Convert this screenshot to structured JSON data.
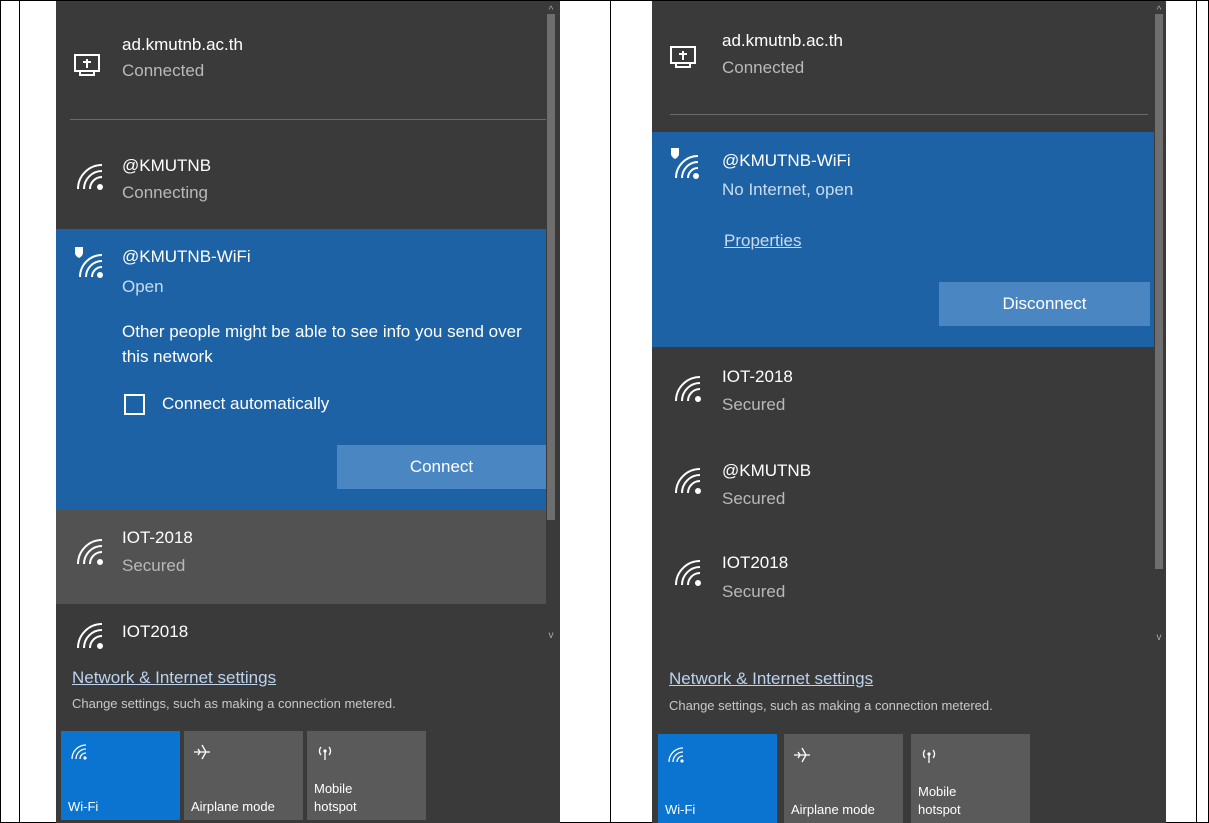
{
  "left": {
    "wired": {
      "name": "ad.kmutnb.ac.th",
      "status": "Connected"
    },
    "networks": [
      {
        "name": "@KMUTNB",
        "status": "Connecting"
      },
      {
        "name": "@KMUTNB-WiFi",
        "status": "Open"
      },
      {
        "name": "IOT-2018",
        "status": "Secured"
      },
      {
        "name": "IOT2018",
        "status": ""
      }
    ],
    "warning": "Other people might be able to see info you send over this network",
    "auto_connect_label": "Connect automatically",
    "auto_connect_checked": false,
    "connect_button": "Connect",
    "settings_link": "Network & Internet settings",
    "settings_hint": "Change settings, such as making a connection metered.",
    "tiles": [
      {
        "label": "Wi-Fi",
        "active": true,
        "icon": "wifi-icon"
      },
      {
        "label": "Airplane mode",
        "active": false,
        "icon": "airplane-icon"
      },
      {
        "label": "Mobile hotspot",
        "line1": "Mobile",
        "line2": "hotspot",
        "active": false,
        "icon": "hotspot-icon"
      }
    ]
  },
  "right": {
    "wired": {
      "name": "ad.kmutnb.ac.th",
      "status": "Connected"
    },
    "selected": {
      "name": "@KMUTNB-WiFi",
      "status": "No Internet, open"
    },
    "properties_link": "Properties",
    "disconnect_button": "Disconnect",
    "networks": [
      {
        "name": "IOT-2018",
        "status": "Secured"
      },
      {
        "name": "@KMUTNB",
        "status": "Secured"
      },
      {
        "name": "IOT2018",
        "status": "Secured"
      }
    ],
    "settings_link": "Network & Internet settings",
    "settings_hint": "Change settings, such as making a connection metered.",
    "tiles": [
      {
        "label": "Wi-Fi",
        "active": true,
        "icon": "wifi-icon"
      },
      {
        "label": "Airplane mode",
        "active": false,
        "icon": "airplane-icon"
      },
      {
        "label": "Mobile hotspot",
        "line1": "Mobile",
        "line2": "hotspot",
        "active": false,
        "icon": "hotspot-icon"
      }
    ]
  },
  "colors": {
    "panel_bg": "#3a3a3a",
    "selected_bg": "#1e62a6",
    "button_bg": "#4a87c2",
    "tile_active": "#0a74d0",
    "tile_inactive": "#5a5a5a",
    "link_color": "#bcd3ee"
  }
}
